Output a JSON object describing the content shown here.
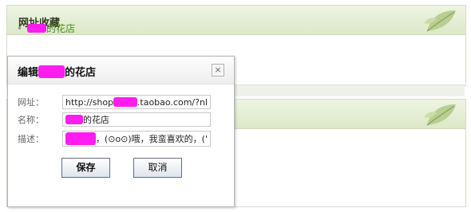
{
  "panel1": {
    "title": "网址收藏"
  },
  "link": {
    "text": "的花店"
  },
  "dialog": {
    "title_prefix": "编辑",
    "title_suffix": "的花店",
    "close_glyph": "×",
    "url_label": "网址：",
    "url_prefix": "http://shop",
    "url_suffix": ".taobao.com/?nl",
    "name_label": "名称：",
    "name_suffix": "的花店",
    "desc_label": "描述：",
    "desc_suffix": "，(⊙o⊙)哦，我蛮喜欢的，('",
    "save_label": "保存",
    "cancel_label": "取消"
  },
  "colors": {
    "redaction": "#ff1cf0",
    "link": "#4a8a1e"
  },
  "icons": {
    "leaf": "leaf-icon",
    "close": "close-icon"
  }
}
